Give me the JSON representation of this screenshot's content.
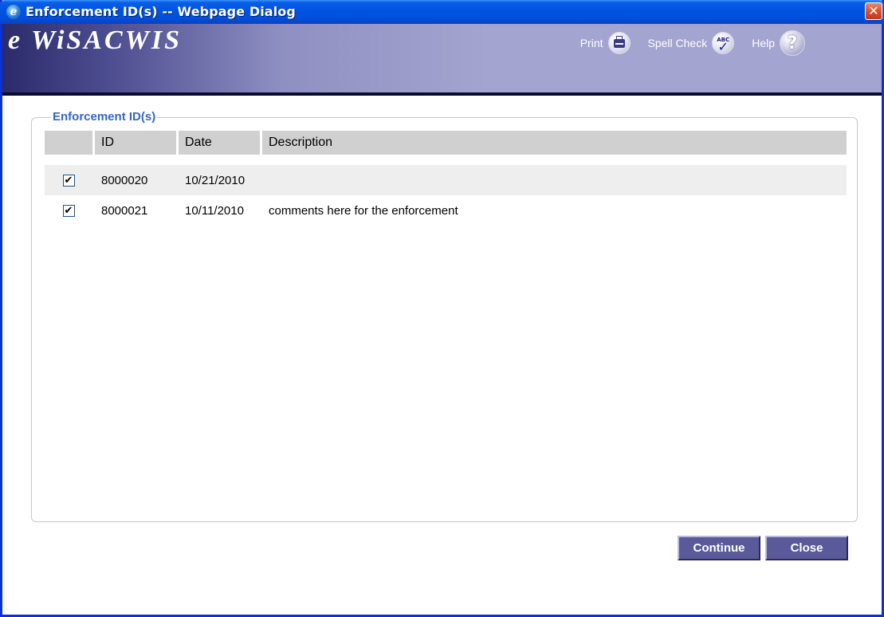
{
  "window": {
    "title": "Enforcement ID(s) -- Webpage Dialog",
    "close_symbol": "✕"
  },
  "banner": {
    "logo": "e WiSACWIS",
    "tools": {
      "print_label": "Print",
      "spell_check_label": "Spell Check",
      "spell_check_icon_text": "ABC",
      "help_label": "Help",
      "help_icon_text": "?"
    }
  },
  "section": {
    "legend": "Enforcement ID(s)",
    "columns": [
      "",
      "ID",
      "Date",
      "Description"
    ],
    "rows": [
      {
        "checked": "✔",
        "id": "8000020",
        "date": "10/21/2010",
        "description": ""
      },
      {
        "checked": "✔",
        "id": "8000021",
        "date": "10/11/2010",
        "description": "comments here for the enforcement"
      }
    ]
  },
  "buttons": {
    "continue_label": "Continue",
    "close_label": "Close"
  },
  "colors": {
    "titlebar": "#0054e3",
    "banner_light": "#a3a4cf",
    "button": "#5a5a9a",
    "legend_text": "#3366cc",
    "header_bg": "#d0d0d0",
    "alt_row_bg": "#eeeeee"
  },
  "icons": {
    "title": "ie-icon",
    "close": "close-icon",
    "print": "printer-icon",
    "spell_check": "spell-check-icon",
    "help": "help-icon"
  }
}
